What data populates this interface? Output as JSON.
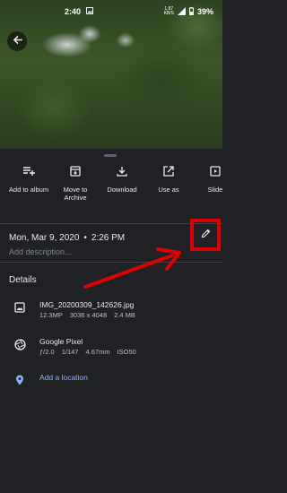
{
  "status_bar": {
    "time": "2:40",
    "network_speed_value": "1.87",
    "network_speed_unit": "KB/S",
    "battery": "39%"
  },
  "photo": {
    "back_icon": "arrow-left-icon"
  },
  "actions": [
    {
      "label": "Add to album",
      "icon": "playlist-add-icon"
    },
    {
      "label": "Move to Archive",
      "icon": "archive-icon"
    },
    {
      "label": "Download",
      "icon": "download-icon"
    },
    {
      "label": "Use as",
      "icon": "open-in-new-icon"
    },
    {
      "label": "Slide",
      "icon": "slideshow-icon"
    }
  ],
  "info": {
    "date": "Mon, Mar 9, 2020",
    "separator": "•",
    "time": "2:26 PM",
    "description_placeholder": "Add description...",
    "edit_icon": "pencil-icon"
  },
  "details": {
    "title": "Details",
    "file": {
      "name": "IMG_20200309_142626.jpg",
      "megapixels": "12.3MP",
      "resolution": "3036 x 4048",
      "size": "2.4 MB"
    },
    "camera": {
      "model": "Google Pixel",
      "aperture": "ƒ/2.0",
      "shutter": "1/147",
      "focal_length": "4.67mm",
      "iso": "ISO50"
    },
    "location": {
      "label": "Add a location"
    }
  },
  "colors": {
    "sheet_background": "#202124",
    "link": "#8ab4f8",
    "highlight": "#e00000"
  }
}
